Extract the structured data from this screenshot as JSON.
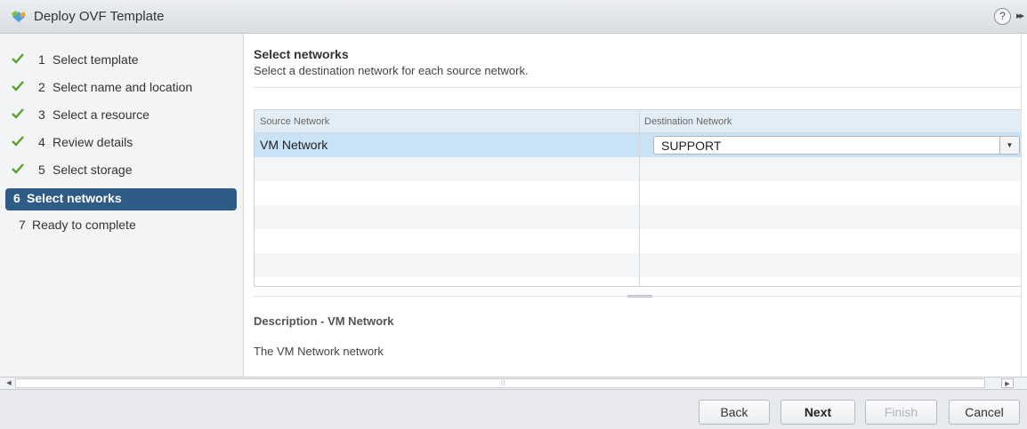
{
  "window": {
    "title": "Deploy OVF Template",
    "help_glyph": "?",
    "expand_glyph": "▸▸"
  },
  "steps": [
    {
      "num": "1",
      "label": "Select template",
      "status": "done"
    },
    {
      "num": "2",
      "label": "Select name and location",
      "status": "done"
    },
    {
      "num": "3",
      "label": "Select a resource",
      "status": "done"
    },
    {
      "num": "4",
      "label": "Review details",
      "status": "done"
    },
    {
      "num": "5",
      "label": "Select storage",
      "status": "done"
    },
    {
      "num": "6",
      "label": "Select networks",
      "status": "active"
    },
    {
      "num": "7",
      "label": "Ready to complete",
      "status": "pending"
    }
  ],
  "main": {
    "heading": "Select networks",
    "subheading": "Select a destination network for each source network.",
    "table": {
      "columns": [
        "Source Network",
        "Destination Network"
      ],
      "rows": [
        {
          "source": "VM Network",
          "destination": "SUPPORT"
        }
      ]
    },
    "description_title": "Description - VM Network",
    "description_text": "The VM Network network"
  },
  "buttons": {
    "back": "Back",
    "next": "Next",
    "finish": "Finish",
    "cancel": "Cancel"
  },
  "colors": {
    "active_step": "#2f5b87",
    "check": "#5aa02c",
    "selected_row": "#c9e2f6",
    "header_row": "#e3edf6"
  }
}
